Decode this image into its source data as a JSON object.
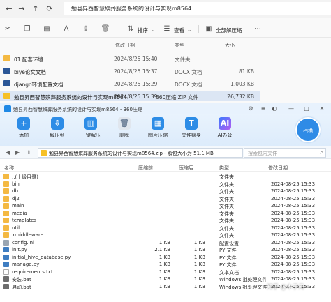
{
  "explorer": {
    "address": "勉县昇西智慧殡葬服务系统的设计与实现m8564",
    "toolbar": {
      "sort": "排序",
      "view": "查看",
      "extract_all": "全部解压缩"
    },
    "columns": [
      "修改日期",
      "类型",
      "大小"
    ],
    "rows": [
      {
        "name": "01 配套环境",
        "date": "2024/8/25 15:40",
        "type": "文件夹",
        "size": ""
      },
      {
        "name": "biye论文文档",
        "date": "2024/8/25 15:37",
        "type": "DOCX 文档",
        "size": "81 KB"
      },
      {
        "name": "django环境配置文档",
        "date": "2024/8/25 15:29",
        "type": "DOCX 文档",
        "size": "1,003 KB"
      },
      {
        "name": "勉县昇西智慧殡葬服务系统的设计与实现m8564",
        "date": "2024/8/25 15:39",
        "type": "360压缩 ZIP 文件",
        "size": "26,732 KB"
      }
    ]
  },
  "zip": {
    "title": "勉县昇西智慧殡葬服务系统的设计与实现m8564 - 360压缩",
    "ribbon": [
      "添加",
      "解压到",
      "一键解压",
      "删除",
      "图片压缩",
      "文件瘦身",
      "AI办公"
    ],
    "scan": "扫描",
    "path": "勉县昇西智慧殡葬服务系统的设计与实现m8564.zip - 解包大小为 51.1 MB",
    "search_placeholder": "搜索包内文件",
    "columns": [
      "名称",
      "压缩前",
      "压缩后",
      "类型",
      "修改日期"
    ],
    "rows": [
      {
        "name": "..(上级目录)",
        "before": "",
        "after": "",
        "type": "文件夹",
        "date": "",
        "kind": "up"
      },
      {
        "name": "bin",
        "before": "",
        "after": "",
        "type": "文件夹",
        "date": "2024-08-25 15:33",
        "kind": "folder"
      },
      {
        "name": "db",
        "before": "",
        "after": "",
        "type": "文件夹",
        "date": "2024-08-25 15:33",
        "kind": "folder"
      },
      {
        "name": "dj2",
        "before": "",
        "after": "",
        "type": "文件夹",
        "date": "2024-08-25 15:33",
        "kind": "folder"
      },
      {
        "name": "main",
        "before": "",
        "after": "",
        "type": "文件夹",
        "date": "2024-08-25 15:33",
        "kind": "folder"
      },
      {
        "name": "media",
        "before": "",
        "after": "",
        "type": "文件夹",
        "date": "2024-08-25 15:33",
        "kind": "folder"
      },
      {
        "name": "templates",
        "before": "",
        "after": "",
        "type": "文件夹",
        "date": "2024-08-25 15:33",
        "kind": "folder"
      },
      {
        "name": "util",
        "before": "",
        "after": "",
        "type": "文件夹",
        "date": "2024-08-25 15:33",
        "kind": "folder"
      },
      {
        "name": "xmiddleware",
        "before": "",
        "after": "",
        "type": "文件夹",
        "date": "2024-08-25 15:33",
        "kind": "folder"
      },
      {
        "name": "config.ini",
        "before": "1 KB",
        "after": "1 KB",
        "type": "配置设置",
        "date": "2024-08-25 15:33",
        "kind": "cfg"
      },
      {
        "name": "init.py",
        "before": "2.1 KB",
        "after": "1 KB",
        "type": "PY 文件",
        "date": "2024-08-25 15:33",
        "kind": "py"
      },
      {
        "name": "initial_hive_database.py",
        "before": "1 KB",
        "after": "1 KB",
        "type": "PY 文件",
        "date": "2024-08-25 15:33",
        "kind": "py"
      },
      {
        "name": "manage.py",
        "before": "1 KB",
        "after": "1 KB",
        "type": "PY 文件",
        "date": "2024-08-25 15:33",
        "kind": "py"
      },
      {
        "name": "requirements.txt",
        "before": "1 KB",
        "after": "1 KB",
        "type": "文本文档",
        "date": "2024-08-25 15:33",
        "kind": "file"
      },
      {
        "name": "安装.bat",
        "before": "1 KB",
        "after": "1 KB",
        "type": "Windows 批处理文件",
        "date": "2024-08-25 15:33",
        "kind": "bat"
      },
      {
        "name": "启动.bat",
        "before": "1 KB",
        "after": "1 KB",
        "type": "Windows 批处理文件",
        "date": "2024-08-25 15:33",
        "kind": "bat"
      }
    ]
  },
  "watermark": "知乎 @木子元"
}
